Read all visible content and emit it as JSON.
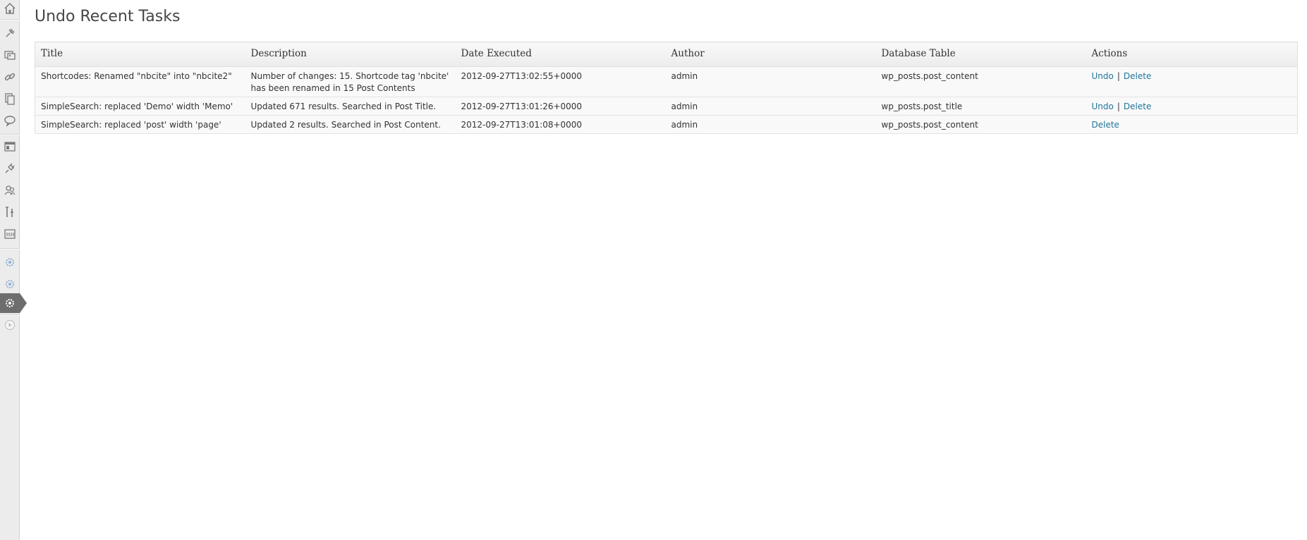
{
  "sidebar": {
    "icons": [
      "dashboard-icon",
      "posts-icon",
      "media-icon",
      "links-icon",
      "pages-icon",
      "comments-icon",
      "appearance-icon",
      "plugins-icon",
      "users-icon",
      "tools-icon",
      "settings-icon",
      "plugin-settings-icon-1",
      "plugin-settings-icon-2",
      "active-plugin-settings-icon",
      "collapse-menu-icon"
    ]
  },
  "page": {
    "title": "Undo Recent Tasks"
  },
  "table": {
    "headers": {
      "title": "Title",
      "description": "Description",
      "date": "Date Executed",
      "author": "Author",
      "db_table": "Database Table",
      "actions": "Actions"
    },
    "rows": [
      {
        "title": "Shortcodes: Renamed \"nbcite\" into \"nbcite2\"",
        "description": "Number of changes: 15. Shortcode tag 'nbcite' has been renamed in 15 Post Contents",
        "date": "2012-09-27T13:02:55+0000",
        "author": "admin",
        "db_table": "wp_posts.post_content",
        "undo": "Undo",
        "separator": "|",
        "delete": "Delete"
      },
      {
        "title": "SimpleSearch: replaced 'Demo' width 'Memo'",
        "description": "Updated 671 results. Searched in Post Title.",
        "date": "2012-09-27T13:01:26+0000",
        "author": "admin",
        "db_table": "wp_posts.post_title",
        "undo": "Undo",
        "separator": "|",
        "delete": "Delete"
      },
      {
        "title": "SimpleSearch: replaced 'post' width 'page'",
        "description": "Updated 2 results. Searched in Post Content.",
        "date": "2012-09-27T13:01:08+0000",
        "author": "admin",
        "db_table": "wp_posts.post_content",
        "delete": "Delete"
      }
    ]
  },
  "colors": {
    "link": "#21759b",
    "sidebar_bg": "#ececec",
    "active_menu": "#6d6d6d",
    "plugin_icon": "#8fb2d6"
  }
}
